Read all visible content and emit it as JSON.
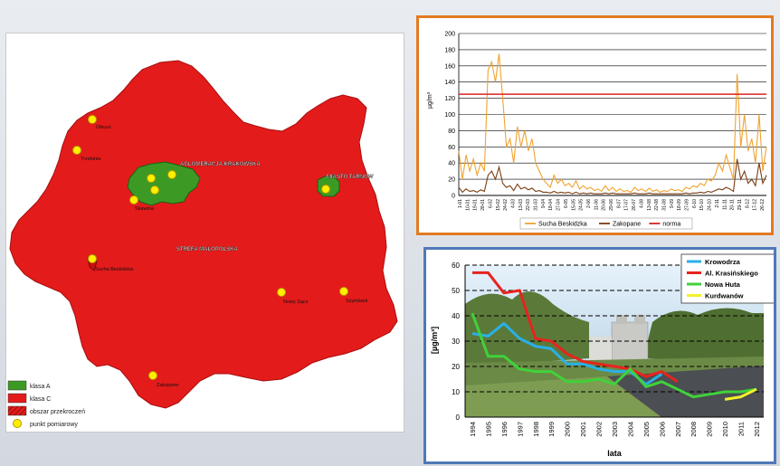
{
  "map": {
    "labels": {
      "aglomeracja": "AGLOMERACJA KRAKOWSKA",
      "tarnow": "MIASTO TARNÓW",
      "strefa": "STREFA MAŁOPOLSKA",
      "olkusz": "Olkusz",
      "trzebinia": "Trzebinia",
      "skawina": "Skawina",
      "sucha": "Sucha Beskidzka",
      "nowy_sacz": "Nowy Sącz",
      "gorlice": "Szymbark",
      "zakopane": "Zakopane"
    },
    "legend": [
      {
        "label": "klasa A",
        "color": "#3c9a24"
      },
      {
        "label": "klasa C",
        "color": "#e41b1b"
      },
      {
        "label": "obszar przekroczeń",
        "color": "#e41b1b"
      },
      {
        "label": "punkt pomiarowy",
        "color": "#ffee00"
      }
    ]
  },
  "chart_data": [
    {
      "type": "line",
      "ylabel": "µg/m³",
      "ylim": [
        0,
        200
      ],
      "yticks": [
        0,
        20,
        40,
        60,
        80,
        100,
        120,
        140,
        160,
        180,
        200
      ],
      "xticks": [
        "1-01",
        "10-01",
        "19-01",
        "28-01",
        "6-02",
        "15-02",
        "24-02",
        "4-03",
        "13-03",
        "22-03",
        "31-03",
        "9-04",
        "18-04",
        "27-04",
        "6-05",
        "15-05",
        "24-05",
        "2-06",
        "11-06",
        "20-06",
        "29-06",
        "8-07",
        "17-07",
        "26-07",
        "4-08",
        "13-08",
        "22-08",
        "31-08",
        "9-09",
        "18-09",
        "27-09",
        "6-10",
        "15-10",
        "24-10",
        "2-11",
        "11-11",
        "20-11",
        "29-11",
        "8-12",
        "17-12",
        "26-12"
      ],
      "series": [
        {
          "name": "Sucha Beskidzka",
          "color": "#f0a330",
          "values": [
            55,
            20,
            50,
            30,
            45,
            25,
            40,
            30,
            155,
            165,
            140,
            175,
            120,
            60,
            70,
            40,
            85,
            60,
            80,
            55,
            70,
            40,
            30,
            20,
            15,
            10,
            25,
            15,
            20,
            12,
            15,
            10,
            18,
            8,
            12,
            8,
            10,
            6,
            8,
            5,
            12,
            6,
            10,
            5,
            8,
            5,
            6,
            4,
            10,
            6,
            8,
            5,
            9,
            5,
            7,
            4,
            6,
            5,
            8,
            6,
            7,
            5,
            10,
            8,
            12,
            10,
            15,
            12,
            20,
            18,
            25,
            40,
            30,
            50,
            35,
            20,
            150,
            60,
            100,
            55,
            70,
            40,
            100,
            30,
            60
          ]
        },
        {
          "name": "Zakopane",
          "color": "#7a3d12",
          "values": [
            10,
            4,
            8,
            5,
            6,
            4,
            7,
            5,
            25,
            30,
            20,
            35,
            15,
            10,
            12,
            6,
            14,
            8,
            10,
            7,
            9,
            5,
            6,
            4,
            4,
            3,
            5,
            3,
            4,
            3,
            4,
            2,
            4,
            2,
            3,
            2,
            3,
            2,
            2,
            2,
            3,
            2,
            3,
            2,
            2,
            2,
            2,
            2,
            3,
            2,
            2,
            2,
            3,
            2,
            2,
            2,
            2,
            2,
            2,
            2,
            2,
            2,
            3,
            2,
            3,
            3,
            4,
            3,
            5,
            4,
            6,
            8,
            7,
            10,
            8,
            5,
            45,
            20,
            30,
            15,
            20,
            12,
            40,
            15,
            25
          ]
        },
        {
          "name": "norma",
          "color": "#d92323",
          "values": [
            125,
            125
          ]
        }
      ]
    },
    {
      "type": "line",
      "xlabel": "lata",
      "ylabel": "[µg/m³]",
      "ylim": [
        0,
        60
      ],
      "yticks": [
        0,
        10,
        20,
        30,
        40,
        50,
        60
      ],
      "x": [
        "1994",
        "1995",
        "1996",
        "1997",
        "1998",
        "1999",
        "2000",
        "2001",
        "2002",
        "2003",
        "2004",
        "2005",
        "2006",
        "2007",
        "2008",
        "2009",
        "2010",
        "2011",
        "2012"
      ],
      "series": [
        {
          "name": "Krowodrza",
          "color": "#2ab0e8",
          "values": [
            33,
            32,
            37,
            31,
            28,
            27,
            21,
            21,
            19,
            18,
            18,
            13,
            17,
            null,
            null,
            null,
            null,
            null,
            null
          ]
        },
        {
          "name": "Al. Krasińskiego",
          "color": "#e8231e",
          "values": [
            57,
            57,
            49,
            50,
            31,
            30,
            25,
            22,
            21,
            20,
            19,
            16,
            18,
            14,
            null,
            null,
            null,
            null,
            null
          ]
        },
        {
          "name": "Nowa Huta",
          "color": "#3fd23a",
          "values": [
            41,
            24,
            24,
            19,
            18,
            18,
            14,
            14,
            15,
            13,
            19,
            12,
            14,
            11,
            8,
            9,
            10,
            10,
            11
          ]
        },
        {
          "name": "Kurdwanów",
          "color": "#f2f22c",
          "values": [
            null,
            null,
            null,
            null,
            null,
            null,
            null,
            null,
            null,
            null,
            null,
            null,
            null,
            null,
            null,
            null,
            7,
            8,
            11
          ]
        }
      ]
    }
  ]
}
